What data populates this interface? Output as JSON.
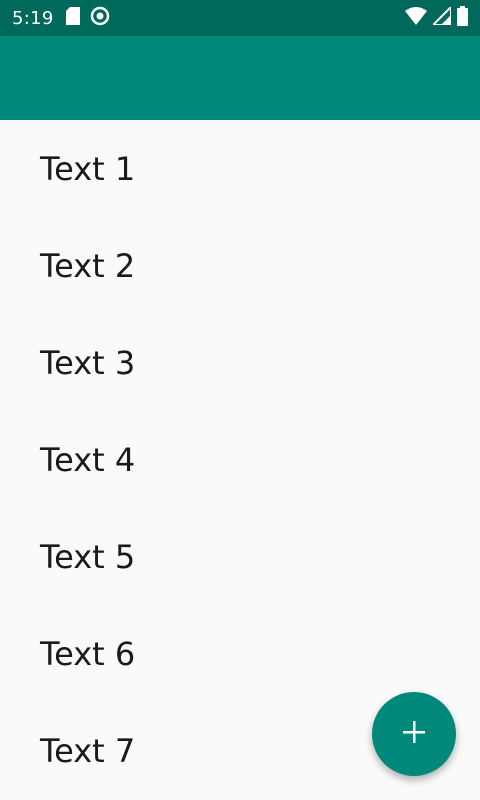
{
  "status_bar": {
    "time": "5:19",
    "icons": [
      "sd-card-icon",
      "sync-icon",
      "wifi-icon",
      "signal-icon",
      "battery-icon"
    ]
  },
  "colors": {
    "status_bar": "#00695c",
    "app_bar": "#00897b",
    "fab": "#00897b",
    "background": "#fafafa"
  },
  "list": {
    "items": [
      "Text 1",
      "Text 2",
      "Text 3",
      "Text 4",
      "Text 5",
      "Text 6",
      "Text 7"
    ]
  },
  "fab": {
    "icon": "plus-icon"
  }
}
